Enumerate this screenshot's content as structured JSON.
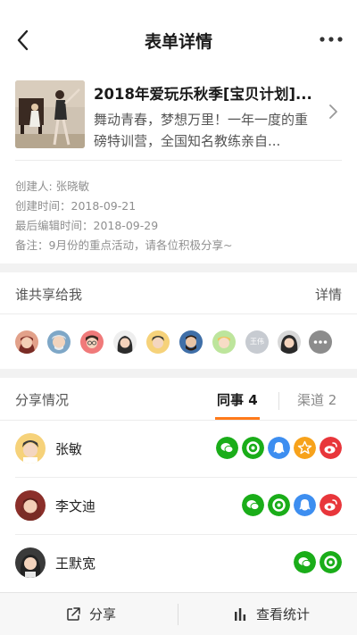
{
  "nav": {
    "title": "表单详情",
    "back_icon": "chevron-left-icon",
    "more_icon": "more-dots-icon"
  },
  "product": {
    "title": "2018年爱玩乐秋季[宝贝计划]...",
    "desc_line1": "舞动青春，梦想万里！一年一度的重",
    "desc_line2": "磅特训营，全国知名教练亲自..."
  },
  "meta": {
    "creator": "创建人: 张晓敏",
    "created": "创建时间：2018-09-21",
    "edited": "最后编辑时间：2018-09-29",
    "note": "备注：9月份的重点活动，请各位积极分享~"
  },
  "shared_with_me": {
    "title": "谁共享给我",
    "link": "详情",
    "text_avatar": "王伟"
  },
  "share_detail": {
    "title": "分享情况",
    "tabs": [
      {
        "label": "同事 4",
        "active": true
      },
      {
        "label": "渠道 2",
        "active": false
      }
    ],
    "rows": [
      {
        "name": "张敏",
        "channels": [
          "wechat",
          "moments",
          "qq",
          "qzone",
          "weibo"
        ]
      },
      {
        "name": "李文迪",
        "channels": [
          "wechat",
          "moments",
          "qq",
          "weibo"
        ]
      },
      {
        "name": "王默宽",
        "channels": [
          "wechat",
          "moments"
        ]
      }
    ]
  },
  "bottom": {
    "share_label": "分享",
    "stats_label": "查看统计"
  },
  "colors": {
    "accent": "#ff7a1a",
    "wechat": "#1aad19",
    "qq": "#3d8ef0",
    "qzone": "#f7a21b",
    "weibo": "#e8363b"
  }
}
